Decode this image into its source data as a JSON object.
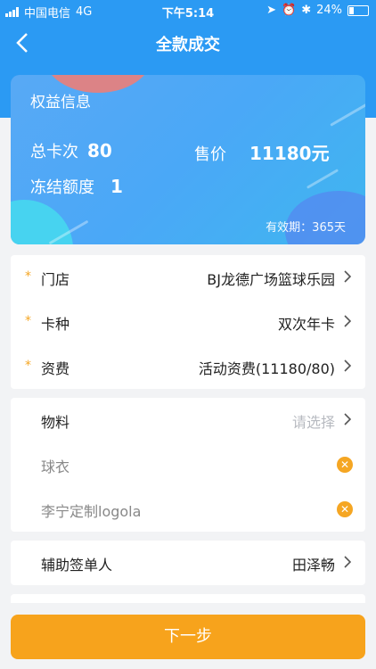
{
  "status": {
    "carrier": "中国电信",
    "network": "4G",
    "time": "下午5:14",
    "battery": "24%"
  },
  "nav": {
    "title": "全款成交"
  },
  "card": {
    "title": "权益信息",
    "total_label": "总卡次",
    "total_value": "80",
    "price_label": "售价",
    "price_value": "11180元",
    "freeze_label": "冻结额度",
    "freeze_value": "1",
    "validity": "有效期：365天"
  },
  "form": {
    "store": {
      "label": "门店",
      "value": "BJ龙德广场篮球乐园"
    },
    "card_type": {
      "label": "卡种",
      "value": "双次年卡"
    },
    "fee": {
      "label": "资费",
      "value": "活动资费(11180/80)"
    }
  },
  "materials": {
    "label": "物料",
    "placeholder": "请选择",
    "items": [
      "球衣",
      "李宁定制logola"
    ]
  },
  "assistant": {
    "label": "辅助签单人",
    "value": "田泽畅"
  },
  "next_button": "下一步",
  "colors": {
    "primary": "#2b9af3",
    "accent": "#f7a31c"
  }
}
